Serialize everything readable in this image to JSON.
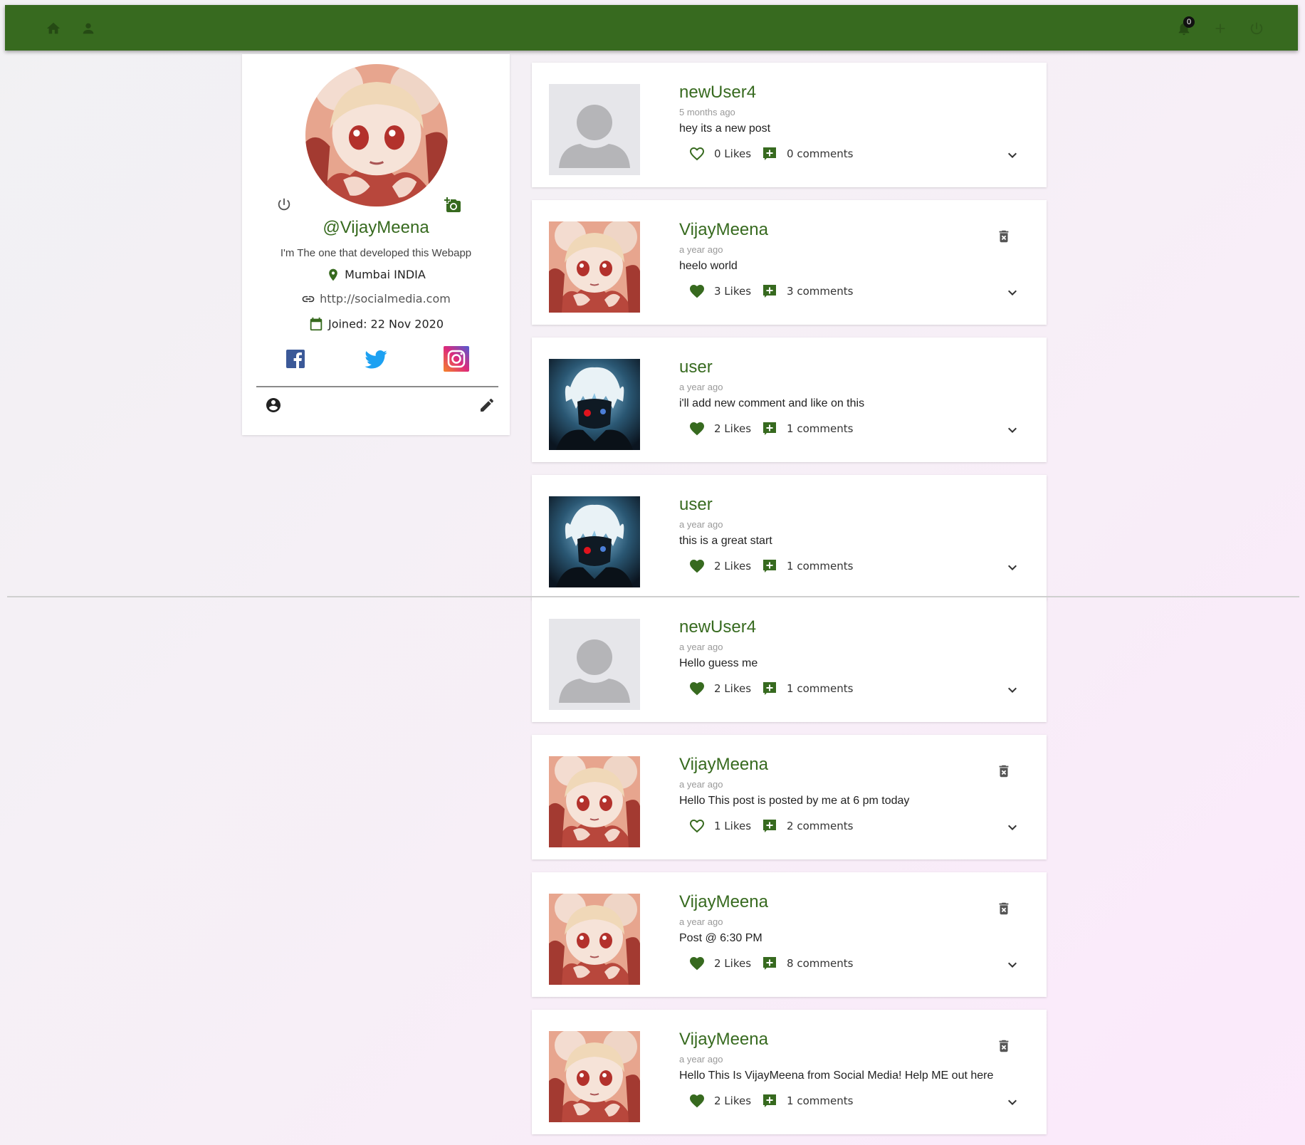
{
  "navbar": {
    "home_icon": "home-icon",
    "profile_icon": "person-icon",
    "notifications_icon": "bell-icon",
    "notification_count": "0",
    "add_post_icon": "plus-icon",
    "logout_icon": "power-icon",
    "color": "#376a1f"
  },
  "profile": {
    "handle": "@VijayMeena",
    "bio": "I'm The one that developed this Webapp",
    "location": "Mumbai INDIA",
    "website": "http://socialmedia.com",
    "joined": "Joined: 22 Nov 2020",
    "icons": [
      "power-icon",
      "add-photo-icon",
      "location-icon",
      "link-icon",
      "calendar-icon",
      "facebook-icon",
      "twitter-icon",
      "instagram-icon",
      "account-circle-icon",
      "edit-icon"
    ]
  },
  "posts": [
    {
      "user": "newUser4",
      "time": "5 months ago",
      "body": "hey its a new post",
      "likes": "0 Likes",
      "comments": "0 comments",
      "liked": false,
      "avatar": "default",
      "deletable": false
    },
    {
      "user": "VijayMeena",
      "time": "a year ago",
      "body": "heelo world",
      "likes": "3 Likes",
      "comments": "3 comments",
      "liked": true,
      "avatar": "anime",
      "deletable": true
    },
    {
      "user": "user",
      "time": "a year ago",
      "body": "i'll add new comment and like on this",
      "likes": "2 Likes",
      "comments": "1 comments",
      "liked": true,
      "avatar": "dark",
      "deletable": false
    },
    {
      "user": "user",
      "time": "a year ago",
      "body": "this is a great start",
      "likes": "2 Likes",
      "comments": "1 comments",
      "liked": true,
      "avatar": "dark",
      "deletable": false
    },
    {
      "user": "newUser4",
      "time": "a year ago",
      "body": "Hello guess me",
      "likes": "2 Likes",
      "comments": "1 comments",
      "liked": true,
      "avatar": "default",
      "deletable": false
    },
    {
      "user": "VijayMeena",
      "time": "a year ago",
      "body": "Hello This post is posted by me at 6 pm today",
      "likes": "1 Likes",
      "comments": "2 comments",
      "liked": false,
      "avatar": "anime",
      "deletable": true
    },
    {
      "user": "VijayMeena",
      "time": "a year ago",
      "body": "Post @ 6:30 PM",
      "likes": "2 Likes",
      "comments": "8 comments",
      "liked": true,
      "avatar": "anime",
      "deletable": true
    },
    {
      "user": "VijayMeena",
      "time": "a year ago",
      "body": "Hello This Is VijayMeena from Social Media! Help ME out here",
      "likes": "2 Likes",
      "comments": "1 comments",
      "liked": true,
      "avatar": "anime",
      "deletable": true
    }
  ]
}
